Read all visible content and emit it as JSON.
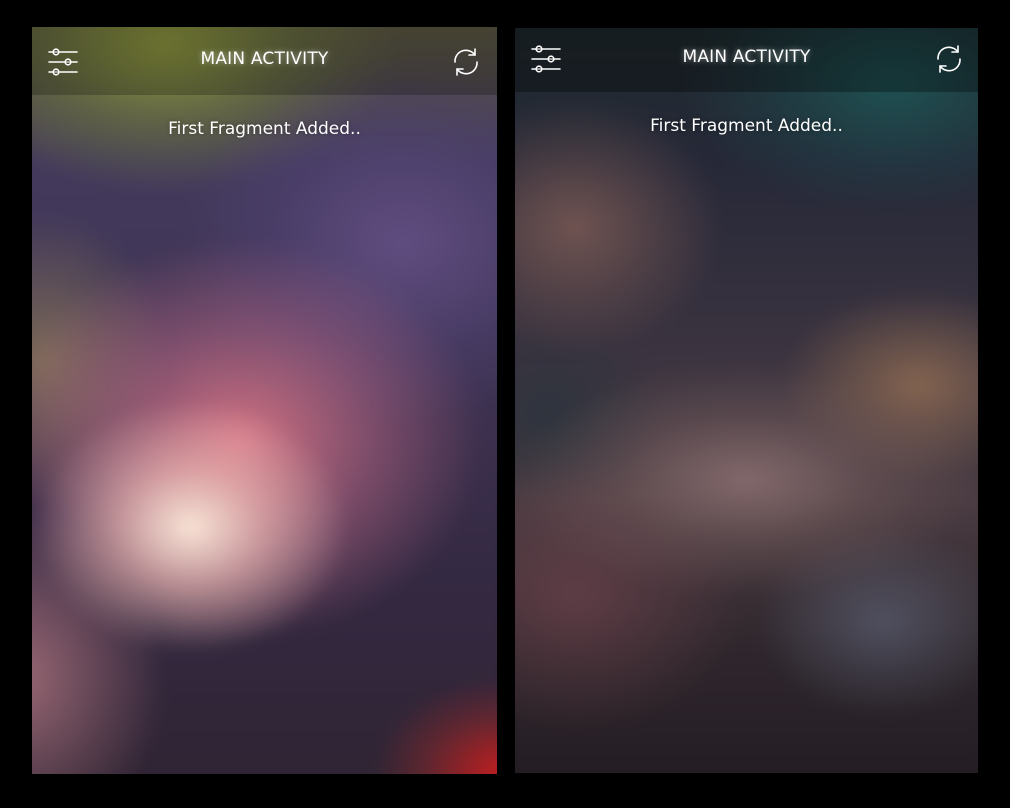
{
  "screens": [
    {
      "app_bar": {
        "menu_icon": "sliders-icon",
        "title": "MAIN ACTIVITY",
        "action_icon": "refresh-icon"
      },
      "content": {
        "message": "First Fragment Added.."
      }
    },
    {
      "app_bar": {
        "menu_icon": "sliders-icon",
        "title": "MAIN ACTIVITY",
        "action_icon": "refresh-icon"
      },
      "content": {
        "message": "First Fragment Added.."
      }
    }
  ],
  "colors": {
    "background": "#000000",
    "text": "#ffffff"
  }
}
